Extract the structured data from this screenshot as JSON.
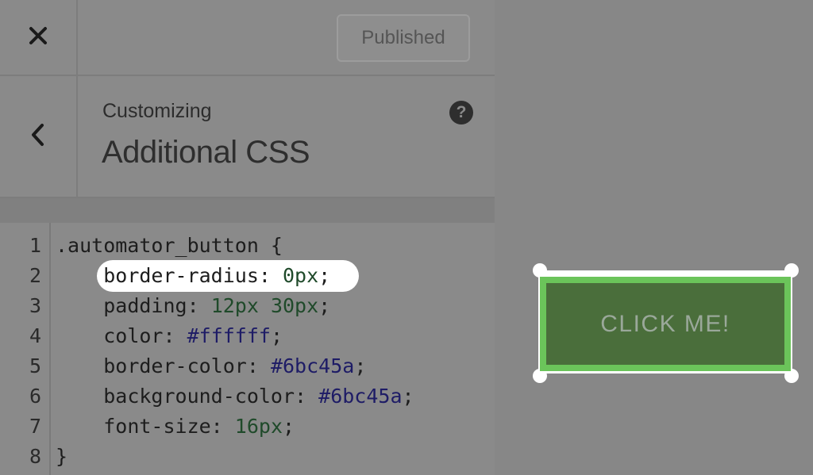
{
  "topbar": {
    "close_icon": "close-icon",
    "publish_label": "Published"
  },
  "header": {
    "back_icon": "chevron-left-icon",
    "breadcrumb": "Customizing",
    "title": "Additional CSS",
    "help_icon": "?"
  },
  "editor": {
    "lines": [
      {
        "num": "1",
        "sel": ".automator_button {",
        "indent": false
      },
      {
        "num": "2",
        "prop": "border-radius:",
        "value": "0px",
        "kind": "num",
        "highlighted": true
      },
      {
        "num": "3",
        "prop": "padding:",
        "value": "12px 30px",
        "kind": "num"
      },
      {
        "num": "4",
        "prop": "color:",
        "value": "#ffffff",
        "kind": "hex"
      },
      {
        "num": "5",
        "prop": "border-color:",
        "value": "#6bc45a",
        "kind": "hex"
      },
      {
        "num": "6",
        "prop": "background-color:",
        "value": "#6bc45a",
        "kind": "hex"
      },
      {
        "num": "7",
        "prop": "font-size:",
        "value": "16px",
        "kind": "num"
      },
      {
        "num": "8",
        "sel": "}",
        "indent": false
      }
    ]
  },
  "preview": {
    "button_label": "CLICK ME!",
    "border_color": "#6bc45a"
  }
}
